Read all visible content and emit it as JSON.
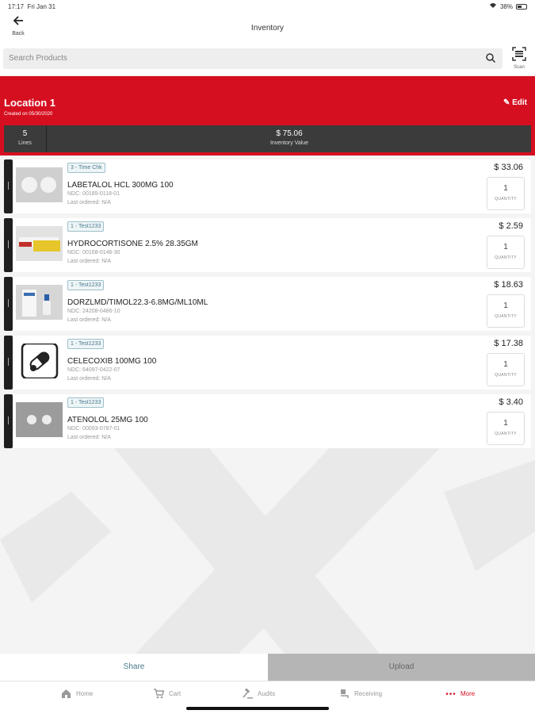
{
  "status_bar": {
    "time": "17:17",
    "date": "Fri Jan 31",
    "battery": "38%"
  },
  "nav": {
    "back_label": "Back",
    "title": "Inventory"
  },
  "search": {
    "placeholder": "Search Products",
    "scan_label": "Scan"
  },
  "location": {
    "name": "Location 1",
    "created": "Created on 05/30/2020",
    "edit_label": "Edit",
    "lines_count": "5",
    "lines_label": "Lines",
    "inventory_value": "$ 75.06",
    "inventory_value_label": "Inventory Value"
  },
  "products": [
    {
      "tag": "3 - Time Chk",
      "name": "LABETALOL HCL 300MG 100",
      "ndc": "NDC: 00185-0118-01",
      "last_ordered": "Last ordered: N/A",
      "price": "$ 33.06",
      "quantity": "1",
      "quantity_label": "QUANTITY"
    },
    {
      "tag": "1 - Test1233",
      "name": "HYDROCORTISONE 2.5%  28.35GM",
      "ndc": "NDC: 00168-0146-30",
      "last_ordered": "Last ordered: N/A",
      "price": "$ 2.59",
      "quantity": "1",
      "quantity_label": "QUANTITY"
    },
    {
      "tag": "1 - Test1233",
      "name": "DORZLMD/TIMOL22.3-6.8MG/ML10ML",
      "ndc": "NDC: 24208-0486-10",
      "last_ordered": "Last ordered: N/A",
      "price": "$ 18.63",
      "quantity": "1",
      "quantity_label": "QUANTITY"
    },
    {
      "tag": "1 - Test1233",
      "name": "CELECOXIB 100MG 100",
      "ndc": "NDC: 64097-0422-07",
      "last_ordered": "Last ordered: N/A",
      "price": "$ 17.38",
      "quantity": "1",
      "quantity_label": "QUANTITY"
    },
    {
      "tag": "1 - Test1233",
      "name": "ATENOLOL 25MG 100",
      "ndc": "NDC: 00093-0787-01",
      "last_ordered": "Last ordered: N/A",
      "price": "$ 3.40",
      "quantity": "1",
      "quantity_label": "QUANTITY"
    }
  ],
  "actions": {
    "share_label": "Share",
    "upload_label": "Upload"
  },
  "tabs": [
    {
      "label": "Home",
      "icon": "home-icon"
    },
    {
      "label": "Cart",
      "icon": "cart-icon"
    },
    {
      "label": "Audits",
      "icon": "gavel-icon"
    },
    {
      "label": "Receiving",
      "icon": "receiving-icon"
    },
    {
      "label": "More",
      "icon": "more-dots-icon"
    }
  ],
  "colors": {
    "brand_red": "#d50f20",
    "summary_dark": "#3b3b3b",
    "tag_teal": "#4a7a8c"
  }
}
